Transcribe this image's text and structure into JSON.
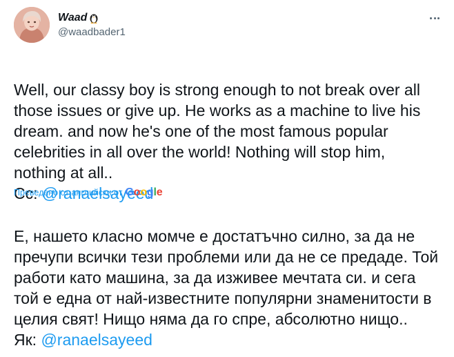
{
  "author": {
    "display_name": "Waad",
    "handle": "@waadbader1",
    "avatar_icon": "profile-photo",
    "name_badge_icon": "penguin-emoji"
  },
  "menu": {
    "icon": "more-horizontal-icon"
  },
  "original": {
    "text": "Well, our classy boy is strong enough to not break over all those issues or give up. He works as a machine to live his dream. and now he's one of the most famous popular celebrities in all over the world! Nothing will stop him, nothing at all..",
    "mention_prefix": "Cc: ",
    "mention": "@ranaelsayeed"
  },
  "translation_notice": {
    "label": "Преведено от английски от",
    "provider": "Google"
  },
  "translated": {
    "text": "Е, нашето класно момче е достатъчно силно, за да не пречупи всички тези проблеми или да не се предаде. Той работи като машина, за да изживее мечтата си. и сега той е една от най-известните популярни знаменитости в целия свят! Нищо няма да го спре, абсолютно нищо..",
    "mention_prefix": "Як: ",
    "mention": "@ranaelsayeed"
  },
  "colors": {
    "link": "#1d9bf0",
    "text": "#0f1419",
    "secondary": "#536471"
  }
}
